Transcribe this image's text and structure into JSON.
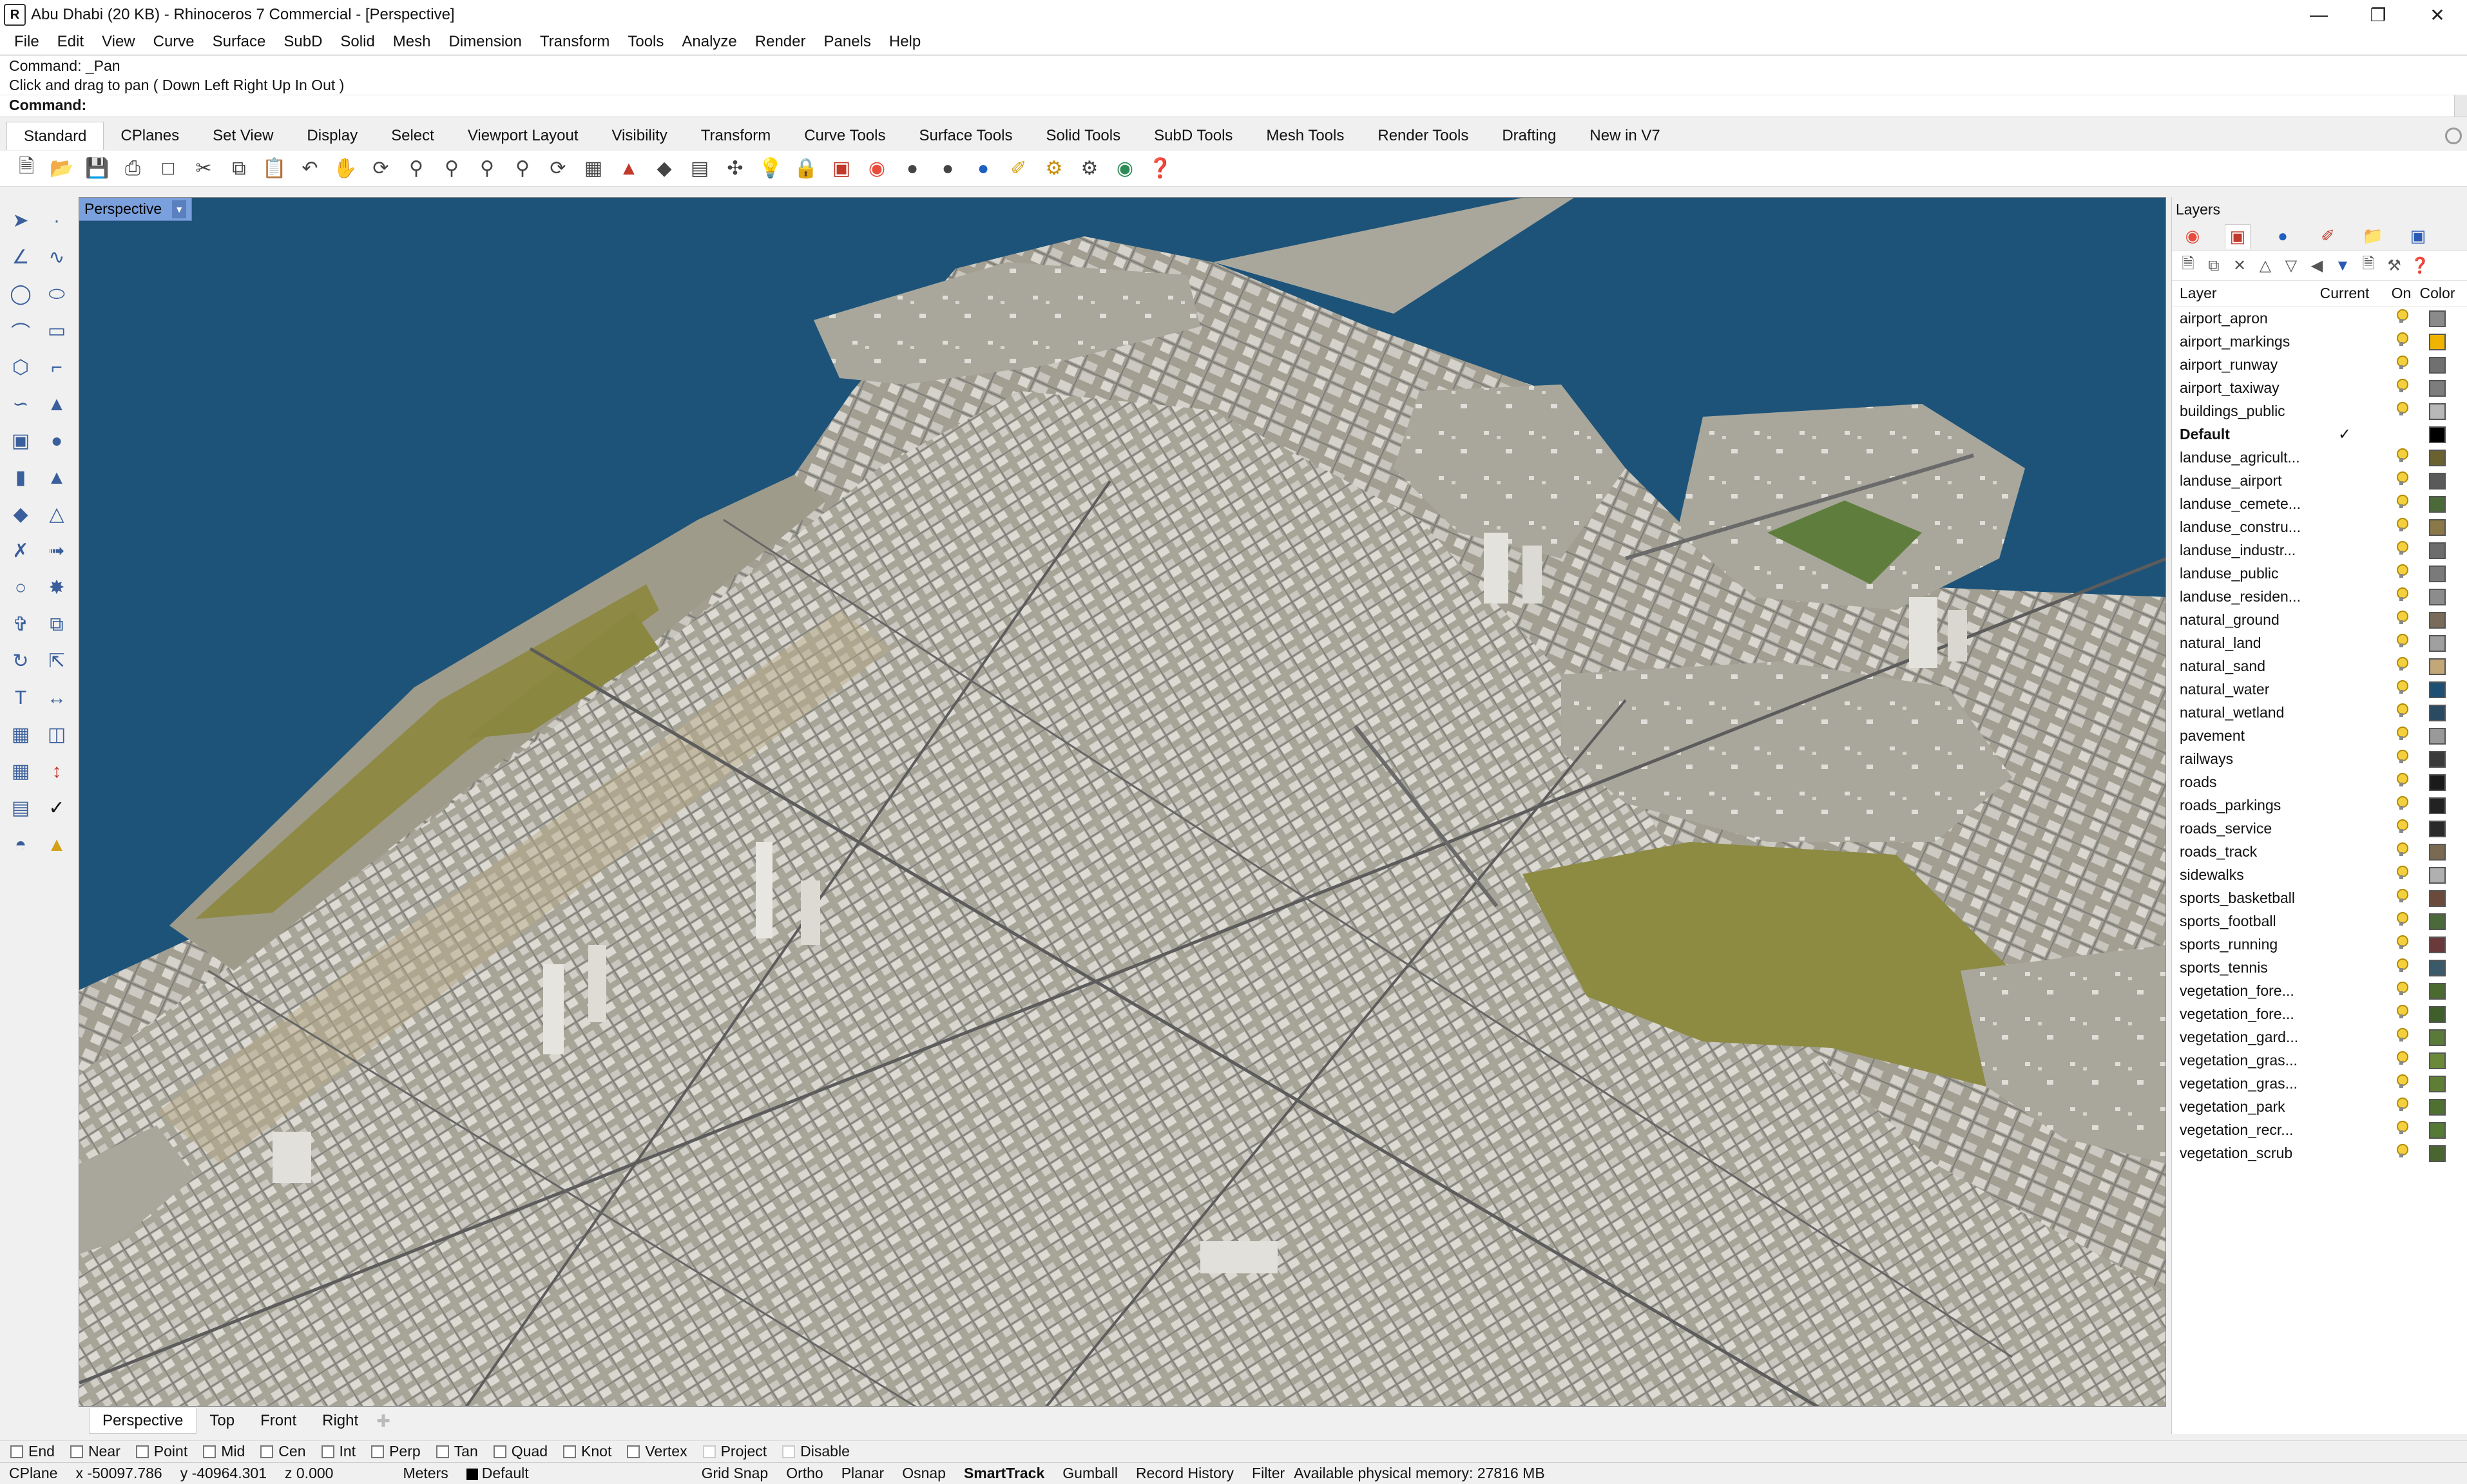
{
  "window": {
    "title": "Abu Dhabi (20 KB) - Rhinoceros 7 Commercial - [Perspective]",
    "app_icon": "rhino-icon",
    "controls": [
      "minimize",
      "maximize",
      "close"
    ]
  },
  "menubar": {
    "items": [
      "File",
      "Edit",
      "View",
      "Curve",
      "Surface",
      "SubD",
      "Solid",
      "Mesh",
      "Dimension",
      "Transform",
      "Tools",
      "Analyze",
      "Render",
      "Panels",
      "Help"
    ]
  },
  "command": {
    "history": [
      "Command: _Pan",
      "Click and drag to pan ( Down  Left  Right  Up  In  Out )"
    ],
    "prompt_label": "Command:",
    "input_value": ""
  },
  "toolbar_tabs": {
    "active": "Standard",
    "items": [
      "Standard",
      "CPlanes",
      "Set View",
      "Display",
      "Select",
      "Viewport Layout",
      "Visibility",
      "Transform",
      "Curve Tools",
      "Surface Tools",
      "Solid Tools",
      "SubD Tools",
      "Mesh Tools",
      "Render Tools",
      "Drafting",
      "New in V7"
    ]
  },
  "standard_icons": [
    "new-file-icon",
    "open-file-icon",
    "save-icon",
    "print-icon",
    "export-icon",
    "cut-icon",
    "copy-icon",
    "paste-icon",
    "undo-icon",
    "pan-hand-icon",
    "rotate-view-icon",
    "zoom-icon",
    "zoom-window-icon",
    "zoom-extents-icon",
    "zoom-selected-icon",
    "named-views-icon",
    "four-viewports-icon",
    "car-icon",
    "properties-icon",
    "grid-icon",
    "gumball-icon",
    "light-icon",
    "lock-icon",
    "layer-icon",
    "color-wheel-icon",
    "shaded-sphere-icon",
    "rendered-sphere-icon",
    "material-sphere-icon",
    "brush-icon",
    "settings-gear-icon",
    "options-icon",
    "globe-icon",
    "help-icon"
  ],
  "viewport": {
    "label": "Perspective",
    "tabs": [
      "Perspective",
      "Top",
      "Front",
      "Right"
    ],
    "active_tab": "Perspective"
  },
  "layers_panel": {
    "title": "Layers",
    "headers": {
      "layer": "Layer",
      "current": "Current",
      "on": "On",
      "color": "Color"
    },
    "layers": [
      {
        "name": "airport_apron",
        "color": "#8a8a8a",
        "current": false
      },
      {
        "name": "airport_markings",
        "color": "#f0b400",
        "current": false
      },
      {
        "name": "airport_runway",
        "color": "#707070",
        "current": false
      },
      {
        "name": "airport_taxiway",
        "color": "#7d7d7d",
        "current": false
      },
      {
        "name": "buildings_public",
        "color": "#b8b8b8",
        "current": false
      },
      {
        "name": "Default",
        "color": "#000000",
        "current": true
      },
      {
        "name": "landuse_agricult...",
        "color": "#6b6030",
        "current": false
      },
      {
        "name": "landuse_airport",
        "color": "#5a5a5a",
        "current": false
      },
      {
        "name": "landuse_cemete...",
        "color": "#4a6a3a",
        "current": false
      },
      {
        "name": "landuse_constru...",
        "color": "#8a7848",
        "current": false
      },
      {
        "name": "landuse_industr...",
        "color": "#6d6d6d",
        "current": false
      },
      {
        "name": "landuse_public",
        "color": "#7a7a7a",
        "current": false
      },
      {
        "name": "landuse_residen...",
        "color": "#8c8c8c",
        "current": false
      },
      {
        "name": "natural_ground",
        "color": "#7a6a5a",
        "current": false
      },
      {
        "name": "natural_land",
        "color": "#a0a0a0",
        "current": false
      },
      {
        "name": "natural_sand",
        "color": "#c2a878",
        "current": false
      },
      {
        "name": "natural_water",
        "color": "#1e4e72",
        "current": false
      },
      {
        "name": "natural_wetland",
        "color": "#2a4a62",
        "current": false
      },
      {
        "name": "pavement",
        "color": "#9a9a9a",
        "current": false
      },
      {
        "name": "railways",
        "color": "#3a3a3a",
        "current": false
      },
      {
        "name": "roads",
        "color": "#1a1a1a",
        "current": false
      },
      {
        "name": "roads_parkings",
        "color": "#222222",
        "current": false
      },
      {
        "name": "roads_service",
        "color": "#2a2a2a",
        "current": false
      },
      {
        "name": "roads_track",
        "color": "#7a6a52",
        "current": false
      },
      {
        "name": "sidewalks",
        "color": "#b0b0b0",
        "current": false
      },
      {
        "name": "sports_basketball",
        "color": "#6a4a3a",
        "current": false
      },
      {
        "name": "sports_football",
        "color": "#4a6a3a",
        "current": false
      },
      {
        "name": "sports_running",
        "color": "#6a3a3a",
        "current": false
      },
      {
        "name": "sports_tennis",
        "color": "#3a5a6a",
        "current": false
      },
      {
        "name": "vegetation_fore...",
        "color": "#4a6a30",
        "current": false
      },
      {
        "name": "vegetation_fore...",
        "color": "#3e5e2a",
        "current": false
      },
      {
        "name": "vegetation_gard...",
        "color": "#5a7a3a",
        "current": false
      },
      {
        "name": "vegetation_gras...",
        "color": "#6a8a3a",
        "current": false
      },
      {
        "name": "vegetation_gras...",
        "color": "#5e7e34",
        "current": false
      },
      {
        "name": "vegetation_park",
        "color": "#4e7030",
        "current": false
      },
      {
        "name": "vegetation_recr...",
        "color": "#557a36",
        "current": false
      },
      {
        "name": "vegetation_scrub",
        "color": "#4a6630",
        "current": false
      }
    ]
  },
  "osnaps": [
    {
      "label": "End",
      "enabled": true
    },
    {
      "label": "Near",
      "enabled": true
    },
    {
      "label": "Point",
      "enabled": true
    },
    {
      "label": "Mid",
      "enabled": true
    },
    {
      "label": "Cen",
      "enabled": true
    },
    {
      "label": "Int",
      "enabled": true
    },
    {
      "label": "Perp",
      "enabled": true
    },
    {
      "label": "Tan",
      "enabled": true
    },
    {
      "label": "Quad",
      "enabled": true
    },
    {
      "label": "Knot",
      "enabled": true
    },
    {
      "label": "Vertex",
      "enabled": true
    },
    {
      "label": "Project",
      "enabled": false
    },
    {
      "label": "Disable",
      "enabled": false
    }
  ],
  "statusbar": {
    "cplane": "CPlane",
    "x": "x -50097.786",
    "y": "y -40964.301",
    "z": "z 0.000",
    "units": "Meters",
    "layer": "Default",
    "toggles": [
      "Grid Snap",
      "Ortho",
      "Planar",
      "Osnap",
      "SmartTrack",
      "Gumball",
      "Record History",
      "Filter"
    ],
    "active_toggle": "SmartTrack",
    "memory": "Available physical memory: 27816 MB"
  },
  "colors": {
    "water": "#1d5379",
    "land": "#a8a598",
    "vegetation": "#8c8a3e",
    "viewport_label_bg": "#7aa0dd"
  }
}
